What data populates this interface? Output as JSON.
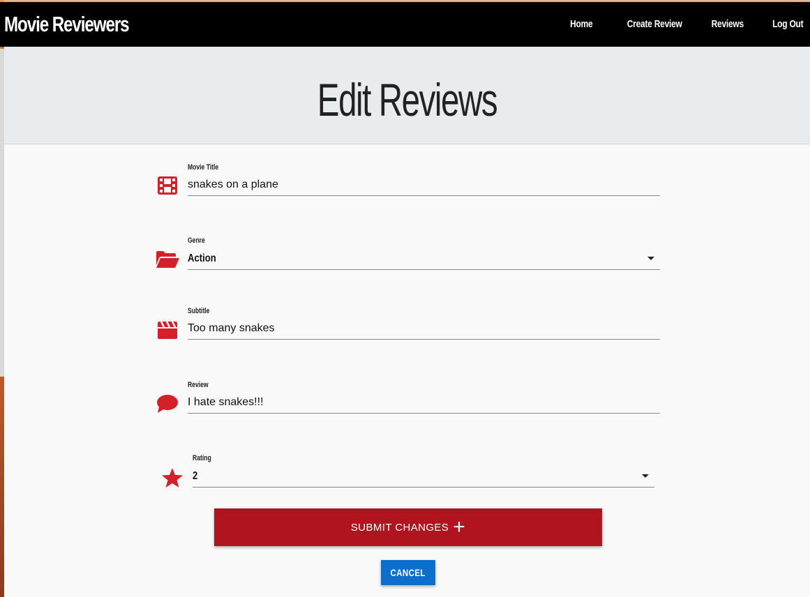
{
  "navbar": {
    "brand": "Movie Reviewers",
    "links": [
      "Home",
      "Create Review",
      "Reviews",
      "Log Out"
    ]
  },
  "hero": {
    "title": "Edit Reviews"
  },
  "form": {
    "movie_title": {
      "label": "Movie Title",
      "value": "snakes on a plane",
      "icon": "film-icon"
    },
    "genre": {
      "label": "Genre",
      "value": "Action",
      "icon": "folder-open-icon"
    },
    "subtitle": {
      "label": "Subtitle",
      "value": "Too many snakes",
      "icon": "clapperboard-icon"
    },
    "review": {
      "label": "Review",
      "value": "I hate snakes!!!",
      "icon": "comment-icon"
    },
    "rating": {
      "label": "Rating",
      "value": "2",
      "icon": "star-icon"
    },
    "submit_label": "SUBMIT CHANGES",
    "submit_icon": "+",
    "cancel_label": "CANCEL"
  },
  "colors": {
    "icon": "#d32029",
    "submit": "#b0141e",
    "cancel": "#0d6fcd",
    "navbar": "#000000",
    "hero": "#e9ecef"
  }
}
